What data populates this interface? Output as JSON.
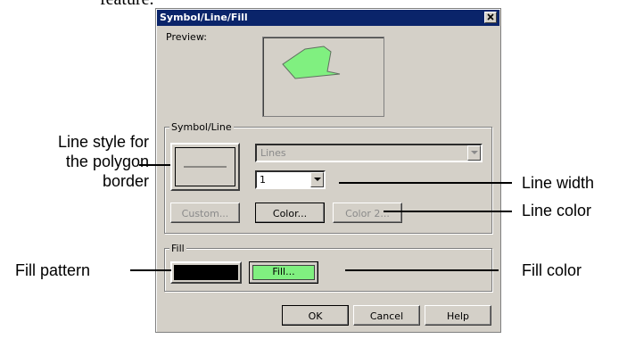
{
  "doc": {
    "text_fragment": "feature."
  },
  "dialog": {
    "title": "Symbol/Line/Fill",
    "preview_label": "Preview:",
    "symbol_line": {
      "group_label": "Symbol/Line",
      "style_select": "Lines",
      "width_select": "1",
      "custom_label": "Custom...",
      "color_label": "Color...",
      "color2_label": "Color 2..."
    },
    "fill": {
      "group_label": "Fill",
      "fill_button_label": "Fill..."
    },
    "footer": {
      "ok_label": "OK",
      "cancel_label": "Cancel",
      "help_label": "Help"
    }
  },
  "callouts": {
    "line_style_1": "Line style for",
    "line_style_2": "the polygon",
    "line_style_3": "border",
    "line_width": "Line width",
    "line_color": "Line color",
    "fill_pattern": "Fill pattern",
    "fill_color": "Fill color"
  },
  "colors": {
    "polygon_fill": "#80f080",
    "fill_button": "#80f080",
    "pattern": "#000000",
    "titlebar": "#0a246a",
    "dialog_bg": "#d4d0c8"
  }
}
